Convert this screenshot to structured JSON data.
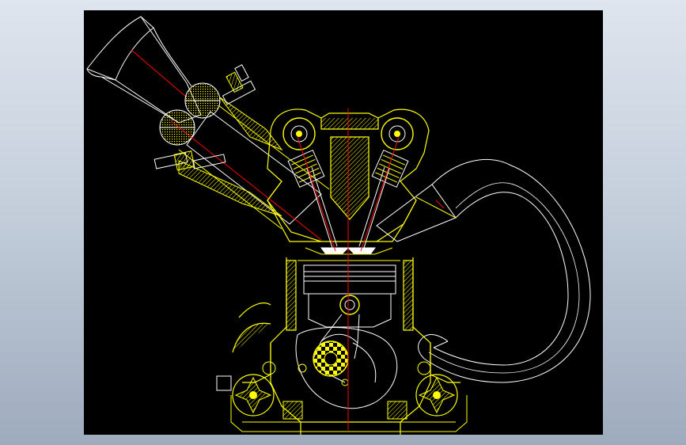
{
  "canvas": {
    "background": "#000000"
  },
  "colors": {
    "yellow": "#ffff00",
    "white": "#ffffff",
    "red": "#ff0000"
  },
  "parts": [
    "intake-trumpet",
    "throttle-body",
    "fuel-injector-upper",
    "fuel-injector-lower",
    "intake-port",
    "exhaust-port",
    "exhaust-header",
    "cylinder-head",
    "camshaft-intake",
    "camshaft-exhaust",
    "valve-spring-intake",
    "valve-spring-exhaust",
    "intake-valve",
    "exhaust-valve",
    "combustion-chamber",
    "piston",
    "wrist-pin",
    "connecting-rod",
    "crankshaft",
    "cylinder-block",
    "balance-shaft-left",
    "balance-shaft-right",
    "oil-pan"
  ]
}
